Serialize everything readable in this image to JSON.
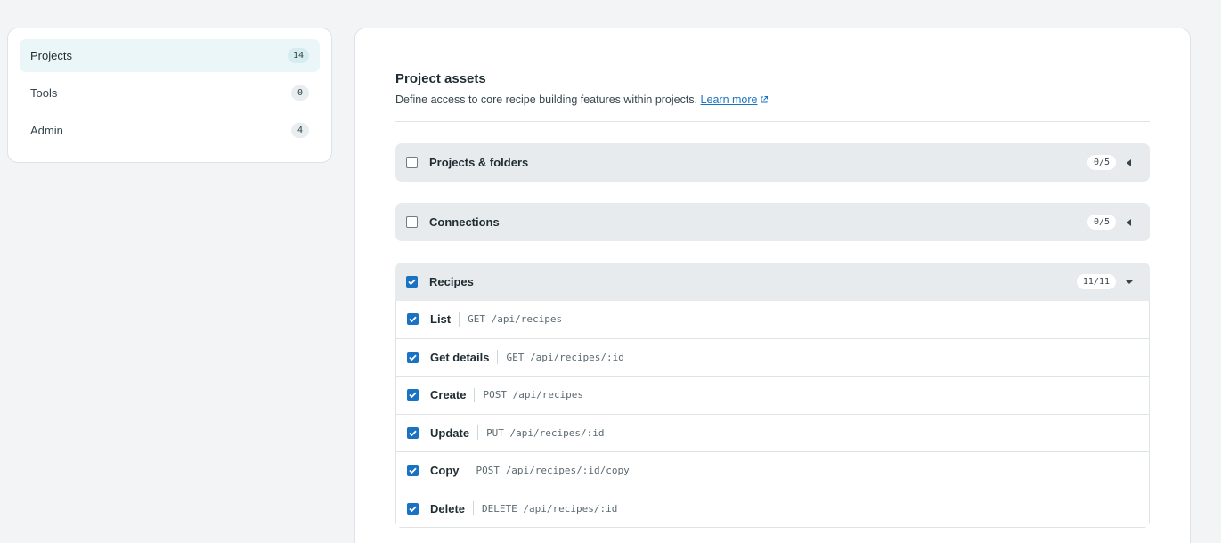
{
  "sidebar": {
    "items": [
      {
        "label": "Projects",
        "count": "14"
      },
      {
        "label": "Tools",
        "count": "0"
      },
      {
        "label": "Admin",
        "count": "4"
      }
    ]
  },
  "main": {
    "title": "Project assets",
    "subtitle": "Define access to core recipe building features within projects.",
    "learn_more": "Learn more",
    "groups": [
      {
        "label": "Projects & folders",
        "count": "0/5",
        "checked": false,
        "expanded": false
      },
      {
        "label": "Connections",
        "count": "0/5",
        "checked": false,
        "expanded": false
      },
      {
        "label": "Recipes",
        "count": "11/11",
        "checked": true,
        "expanded": true
      }
    ],
    "recipes": [
      {
        "name": "List",
        "endpoint": "GET /api/recipes"
      },
      {
        "name": "Get details",
        "endpoint": "GET /api/recipes/:id"
      },
      {
        "name": "Create",
        "endpoint": "POST /api/recipes"
      },
      {
        "name": "Update",
        "endpoint": "PUT /api/recipes/:id"
      },
      {
        "name": "Copy",
        "endpoint": "POST /api/recipes/:id/copy"
      },
      {
        "name": "Delete",
        "endpoint": "DELETE /api/recipes/:id"
      }
    ]
  },
  "colors": {
    "accent": "#1a73c2",
    "active_nav_bg": "#eaf6f7",
    "group_header_bg": "#e8ebed"
  }
}
